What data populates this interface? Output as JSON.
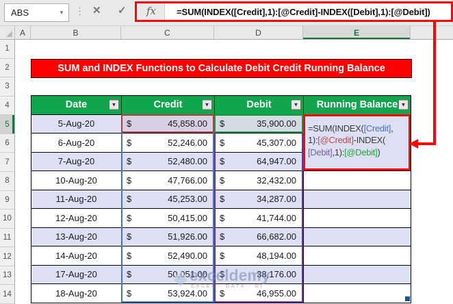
{
  "formula_bar": {
    "name_box_value": "ABS",
    "name_box_dropdown_icon": "▾",
    "grip_icon": "⋮",
    "cancel_icon": "✕",
    "enter_icon": "✓",
    "fx_icon": "fx",
    "formula": "=SUM(INDEX([Credit],1):[@Credit]-INDEX([Debit],1):[@Debit])"
  },
  "grid": {
    "column_headers": [
      "A",
      "B",
      "C",
      "D",
      "E"
    ],
    "selected_column": "E",
    "row_headers": [
      "1",
      "2",
      "3",
      "4",
      "5",
      "6",
      "7",
      "8",
      "9",
      "10",
      "11",
      "12",
      "13",
      "14"
    ],
    "selected_row": "5"
  },
  "banner": {
    "title": "SUM and INDEX Functions to Calculate Debit Credit Running Balance"
  },
  "table": {
    "headers": [
      "Date",
      "Credit",
      "Debit",
      "Running Balance"
    ],
    "filter_icon": "▼",
    "currency": "$",
    "rows": [
      {
        "date": "5-Aug-20",
        "credit": "45,858.00",
        "debit": "35,900.00",
        "balance": ""
      },
      {
        "date": "6-Aug-20",
        "credit": "52,246.00",
        "debit": "45,307.00",
        "balance": ""
      },
      {
        "date": "7-Aug-20",
        "credit": "52,480.00",
        "debit": "64,947.00",
        "balance": ""
      },
      {
        "date": "10-Aug-20",
        "credit": "47,766.00",
        "debit": "32,432.00",
        "balance": ""
      },
      {
        "date": "11-Aug-20",
        "credit": "45,253.00",
        "debit": "34,287.00",
        "balance": ""
      },
      {
        "date": "12-Aug-20",
        "credit": "50,415.00",
        "debit": "41,744.00",
        "balance": ""
      },
      {
        "date": "13-Aug-20",
        "credit": "51,926.00",
        "debit": "66,682.00",
        "balance": ""
      },
      {
        "date": "14-Aug-20",
        "credit": "52,490.00",
        "debit": "48,194.00",
        "balance": ""
      },
      {
        "date": "17-Aug-20",
        "credit": "50,051.00",
        "debit": "38,176.00",
        "balance": ""
      },
      {
        "date": "18-Aug-20",
        "credit": "53,924.00",
        "debit": "46,955.00",
        "balance": ""
      }
    ]
  },
  "formula_cell": {
    "lines": [
      [
        {
          "t": "=SUM(INDEX(",
          "c": "black"
        },
        {
          "t": "[Credit]",
          "c": "blue"
        },
        {
          "t": ",",
          "c": "black"
        }
      ],
      [
        {
          "t": "1):",
          "c": "black"
        },
        {
          "t": "[@Credit]",
          "c": "red"
        },
        {
          "t": "-INDEX(",
          "c": "black"
        }
      ],
      [
        {
          "t": "[Debit]",
          "c": "purple"
        },
        {
          "t": ",1):",
          "c": "black"
        },
        {
          "t": "[@Debit]",
          "c": "green"
        },
        {
          "t": ")",
          "c": "black"
        }
      ]
    ]
  },
  "watermark": {
    "brand": "exceldemy",
    "tagline": "EXCEL · DATA · BI"
  },
  "colors": {
    "header_green": "#11A64D",
    "selected_green": "#217346",
    "banner_red": "#FE0202",
    "annotation_red": "#FB0505",
    "band_lavender": "#DCE0F2",
    "credit_active_fill": "#D8D0E2",
    "debit_active_fill": "#D5DBE4",
    "ref_blue": "#4472C4",
    "ref_red": "#BE4B48",
    "ref_purple": "#7B5BA6",
    "ref_green": "#27A343",
    "ref_black": "#3D3D3D"
  }
}
